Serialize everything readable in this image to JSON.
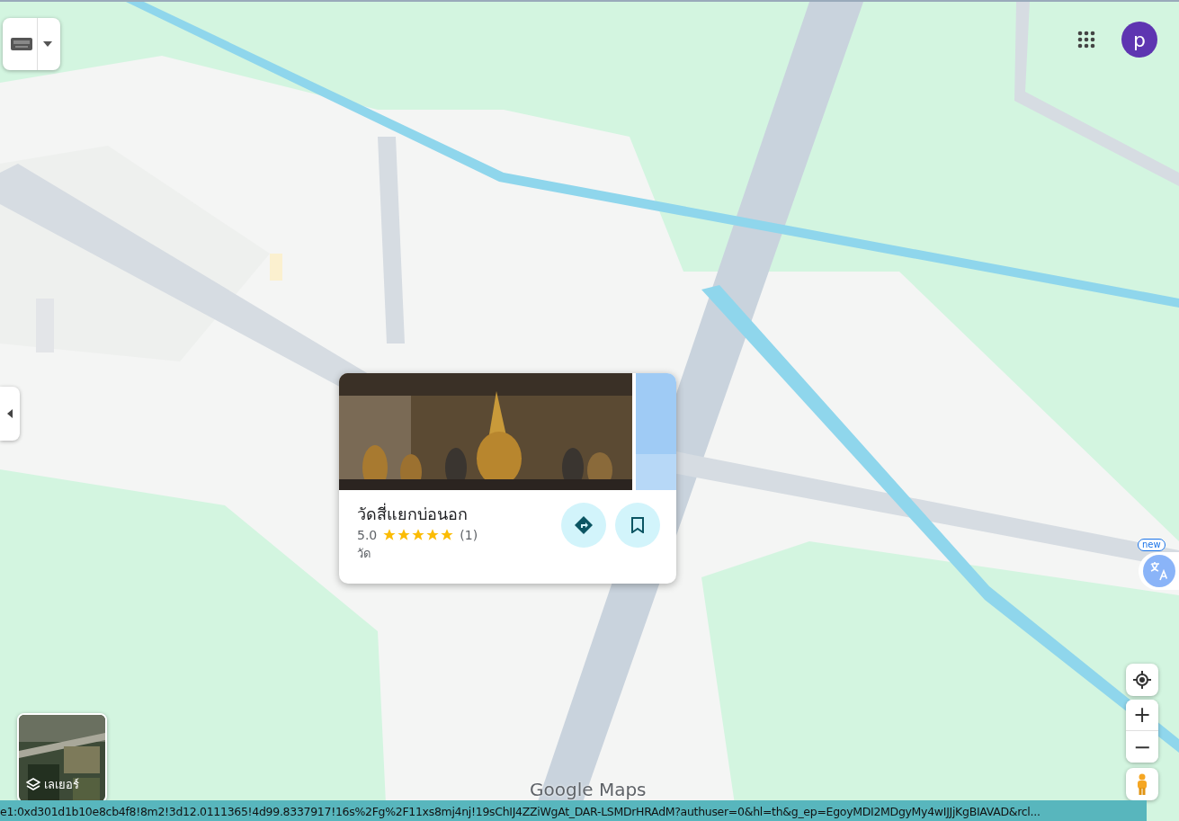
{
  "account": {
    "initial": "p"
  },
  "place_card": {
    "name": "วัดสี่แยกบ่อนอก",
    "rating": "5.0",
    "stars": 5,
    "review_count": "(1)",
    "category": "วัด"
  },
  "translate": {
    "badge": "new"
  },
  "layers": {
    "label": "เลเยอร์"
  },
  "zoom": {
    "in": "+",
    "out": "−"
  },
  "logo": "Google Maps",
  "status_bar": {
    "url": "e1:0xd301d1b10e8cb4f8!8m2!3d12.0111365!4d99.8337917!16s%2Fg%2F11xs8mj4nj!19sChIJ4ZZiWgAt_DAR-LSMDrHRAdM?authuser=0&hl=th&g_ep=EgoyMDI2MDgyMy4wIJJjKgBIAVAD&rcl..."
  }
}
